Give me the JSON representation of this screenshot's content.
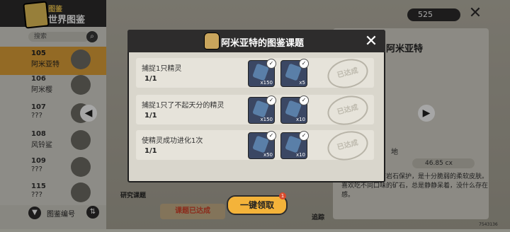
{
  "topbar": {
    "coins": "525"
  },
  "sidebar": {
    "subtitle": "图鉴",
    "title": "世界图鉴",
    "search_placeholder": "搜索",
    "sort_label": "图鉴编号",
    "items": [
      {
        "number": "105",
        "name": "阿米亚特"
      },
      {
        "number": "106",
        "name": "阿米樱"
      },
      {
        "number": "107",
        "name": "???"
      },
      {
        "number": "108",
        "name": "风铃鲨"
      },
      {
        "number": "109",
        "name": "???"
      },
      {
        "number": "115",
        "name": "???"
      }
    ]
  },
  "detail": {
    "name": "阿米亚特",
    "habitat": "地",
    "weight": "46.85 cx",
    "description": "但眼睛周围没有岩石保护，是十分脆弱的柔软皮肤。喜欢吃不同口味的矿石，总是静静呆着，没什么存在感。"
  },
  "bottom": {
    "research_label": "研究课题",
    "done_tab": "课题已达成",
    "claim_label": "一键领取",
    "claim_badge": "1",
    "track_label": "追踪",
    "version": "7543136"
  },
  "modal": {
    "title": "阿米亚特的图鉴课题",
    "tasks": [
      {
        "name": "捕捉1只精灵",
        "progress": "1/1",
        "rewards": [
          {
            "qty": "x150"
          },
          {
            "qty": "x5"
          }
        ],
        "status": "已达成"
      },
      {
        "name": "捕捉1只了不起天分的精灵",
        "progress": "1/1",
        "rewards": [
          {
            "qty": "x150"
          },
          {
            "qty": "x10"
          }
        ],
        "status": "已达成"
      },
      {
        "name": "使精灵成功进化1次",
        "progress": "1/1",
        "rewards": [
          {
            "qty": "x50"
          },
          {
            "qty": "x10"
          }
        ],
        "status": "已达成"
      }
    ]
  }
}
